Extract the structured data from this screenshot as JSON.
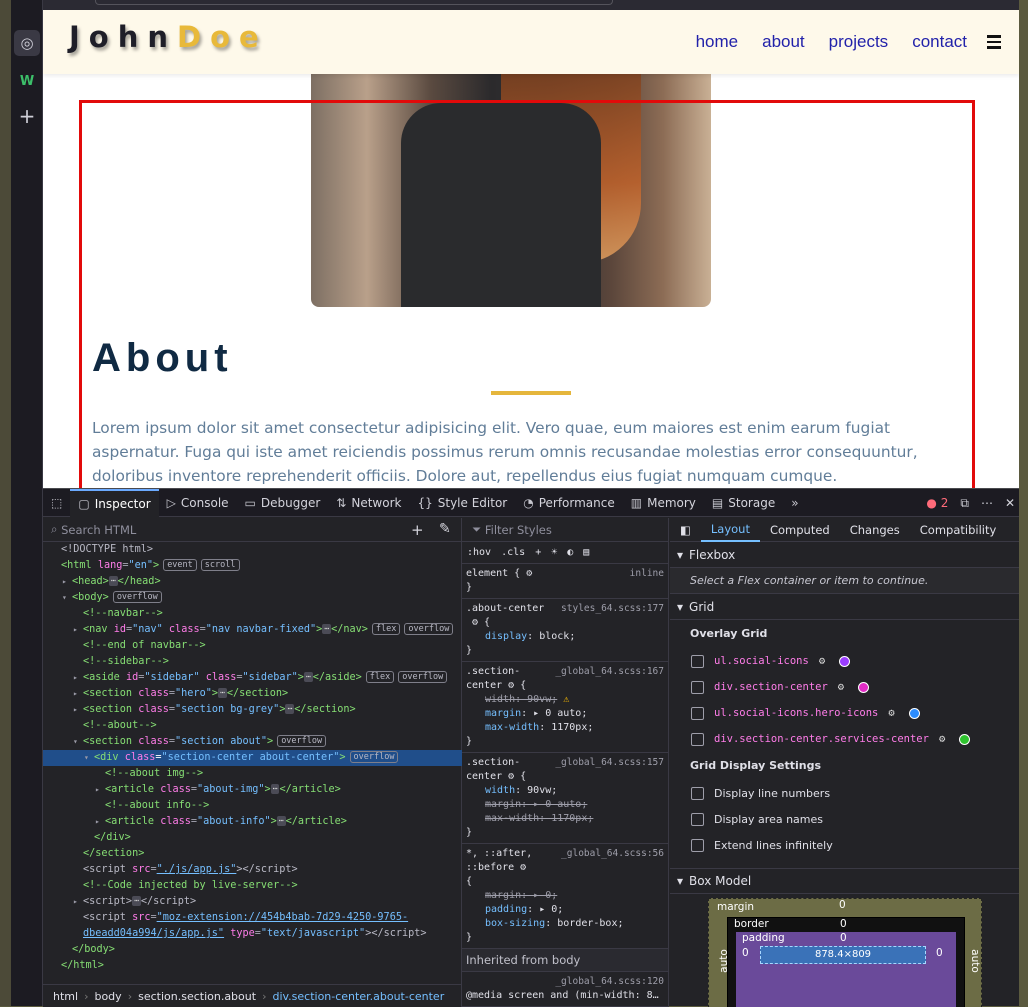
{
  "webpage": {
    "logo_part1": "John",
    "logo_part2": "Doe",
    "nav": [
      "home",
      "about",
      "projects",
      "contact"
    ],
    "about_title": "About",
    "about_text": "Lorem ipsum dolor sit amet consectetur adipisicing elit. Vero quae, eum maiores est enim earum fugiat aspernatur. Fuga qui iste amet reiciendis possimus rerum omnis recusandae molestias error consequuntur, doloribus inventore reprehenderit officiis. Dolore aut, repellendus eius fugiat numquam cumque."
  },
  "devtools": {
    "tabs": [
      "Inspector",
      "Console",
      "Debugger",
      "Network",
      "Style Editor",
      "Performance",
      "Memory",
      "Storage"
    ],
    "error_count": "2",
    "search_placeholder": "Search HTML",
    "breadcrumb": [
      "html",
      "body",
      "section.section.about",
      "div.section-center.about-center"
    ],
    "filter_placeholder": "Filter Styles",
    "hov": ":hov",
    "cls": ".cls",
    "element_rule": "element {",
    "inline": "inline",
    "inherited": "Inherited from body",
    "layout_tabs": [
      "Layout",
      "Computed",
      "Changes",
      "Compatibility"
    ],
    "flexbox_title": "Flexbox",
    "flexbox_note": "Select a Flex container or item to continue.",
    "grid_title": "Grid",
    "overlay_grid": "Overlay Grid",
    "grids": [
      {
        "name": "ul.social-icons",
        "color": "#9b3dff"
      },
      {
        "name": "div.section-center",
        "color": "#e22cc6"
      },
      {
        "name": "ul.social-icons.hero-icons",
        "color": "#2b8cff"
      },
      {
        "name": "div.section-center.services-center",
        "color": "#2ec22e"
      }
    ],
    "grid_settings": "Grid Display Settings",
    "settings": [
      "Display line numbers",
      "Display area names",
      "Extend lines infinitely"
    ],
    "box_model_title": "Box Model",
    "box_model": {
      "margin": "margin",
      "border": "border",
      "padding": "padding",
      "margin_val": "0",
      "border_val": "0",
      "padding_val": "0",
      "content": "878.4×809",
      "auto": "auto"
    }
  }
}
